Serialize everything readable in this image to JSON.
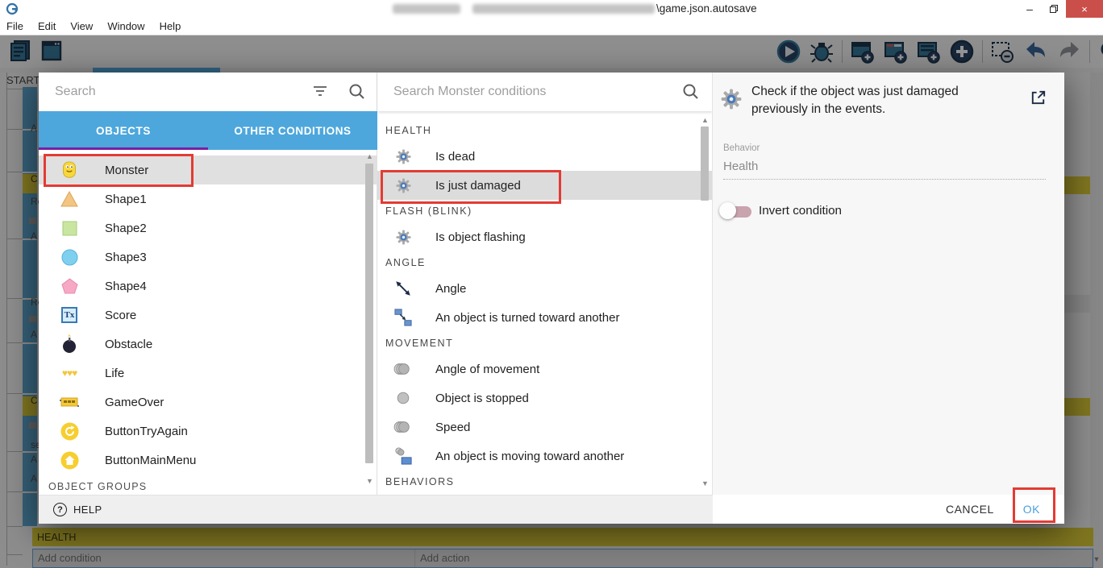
{
  "titlebar": {
    "title_visible": "\\game.json.autosave",
    "minimize_glyph": "–",
    "close_glyph": "×"
  },
  "menubar": {
    "items": [
      "File",
      "Edit",
      "View",
      "Window",
      "Help"
    ]
  },
  "toolbar": {
    "icon_names": [
      "events-list",
      "scene-window",
      "play",
      "debug",
      "add-event",
      "add-comment-event",
      "add-subevent",
      "add-circle",
      "remove-event",
      "undo",
      "redo",
      "search"
    ]
  },
  "background": {
    "scene_tab": "START",
    "event_fragments": [
      "A",
      "C",
      "Re",
      "A",
      "Re",
      "A",
      "C",
      "se",
      "A",
      "A"
    ],
    "health_header": "HEALTH",
    "add_condition_placeholder": "Add condition",
    "add_action_placeholder": "Add action"
  },
  "dialog": {
    "object_panel": {
      "search_placeholder": "Search",
      "tabs": {
        "objects": "OBJECTS",
        "other": "OTHER CONDITIONS"
      },
      "objects": [
        {
          "name": "Monster"
        },
        {
          "name": "Shape1"
        },
        {
          "name": "Shape2"
        },
        {
          "name": "Shape3"
        },
        {
          "name": "Shape4"
        },
        {
          "name": "Score"
        },
        {
          "name": "Obstacle"
        },
        {
          "name": "Life"
        },
        {
          "name": "GameOver"
        },
        {
          "name": "ButtonTryAgain"
        },
        {
          "name": "ButtonMainMenu"
        }
      ],
      "groups_header": "OBJECT GROUPS"
    },
    "condition_panel": {
      "search_placeholder": "Search Monster conditions",
      "sections": [
        {
          "header": "HEALTH",
          "items": [
            {
              "label": "Is dead"
            },
            {
              "label": "Is just damaged"
            }
          ]
        },
        {
          "header": "FLASH (BLINK)",
          "items": [
            {
              "label": "Is object flashing"
            }
          ]
        },
        {
          "header": "ANGLE",
          "items": [
            {
              "label": "Angle"
            },
            {
              "label": "An object is turned toward another"
            }
          ]
        },
        {
          "header": "MOVEMENT",
          "items": [
            {
              "label": "Angle of movement"
            },
            {
              "label": "Object is stopped"
            },
            {
              "label": "Speed"
            },
            {
              "label": "An object is moving toward another"
            }
          ]
        },
        {
          "header": "BEHAVIORS",
          "items": []
        }
      ]
    },
    "detail_panel": {
      "description": "Check if the object was just damaged previously in the events.",
      "behavior_label": "Behavior",
      "behavior_value": "Health",
      "invert_label": "Invert condition"
    },
    "footer": {
      "help": "HELP",
      "cancel": "CANCEL",
      "ok": "OK"
    }
  },
  "colors": {
    "accent_blue": "#4da7dc",
    "tab_underline": "#7b1fa2",
    "annotation_red": "#e33b33",
    "ok_blue": "#4ba1d8",
    "selected_row": "#e0e0e0",
    "health_yellow": "#d8c72e"
  }
}
